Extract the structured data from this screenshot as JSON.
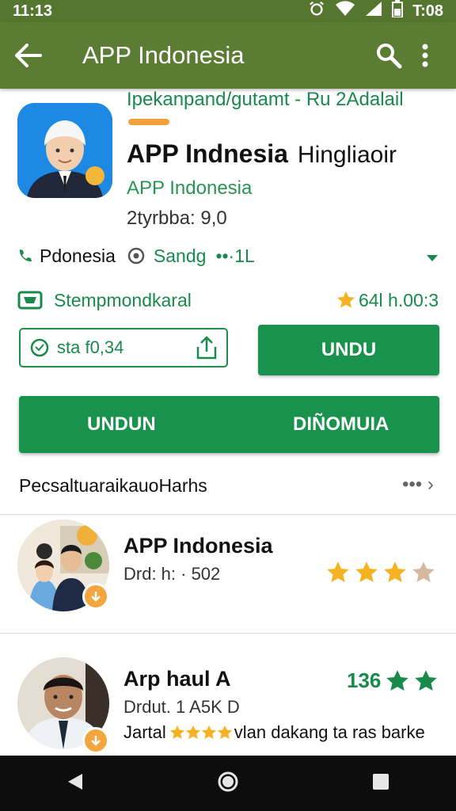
{
  "status_bar": {
    "time": "11:13",
    "time_right": "T:08"
  },
  "app_bar": {
    "title": "APP Indonesia"
  },
  "header": {
    "subtitle_cut": "Ipekanpand/gutamt - Ru 2Adalail",
    "app_name": "APP Indnesia",
    "app_name_extra": "Hingliaoir",
    "developer": "APP Indonesia",
    "version": "2tyrbba: 9,0"
  },
  "info": {
    "location": "Pdonesia",
    "send": "Sandg",
    "network": "••·1L",
    "stamp": "Stempmondkaral",
    "rating": "64l h.00:3"
  },
  "buttons": {
    "size_text": "sta f0,34",
    "undu": "UNDU",
    "wide_left": "UNDUN",
    "wide_right": "DIÑOMUIA"
  },
  "section": {
    "title": "PecsaltuaraikauoHarhs",
    "more": "••• ›"
  },
  "list": [
    {
      "name": "APP Indonesia",
      "sub": "Drd: h: · 502",
      "stars_filled": 3,
      "stars_total": 4
    },
    {
      "name": "Arp haul A",
      "sub": "Drdut. 1 A5K D",
      "count": "136",
      "desc_pre": "Jartal",
      "desc_post": "vlan dakang ta ras barke"
    }
  ],
  "colors": {
    "app_bar": "#5a7c33",
    "primary_green": "#18924d",
    "star": "#f5b324",
    "star_empty": "#d5b8a0"
  }
}
